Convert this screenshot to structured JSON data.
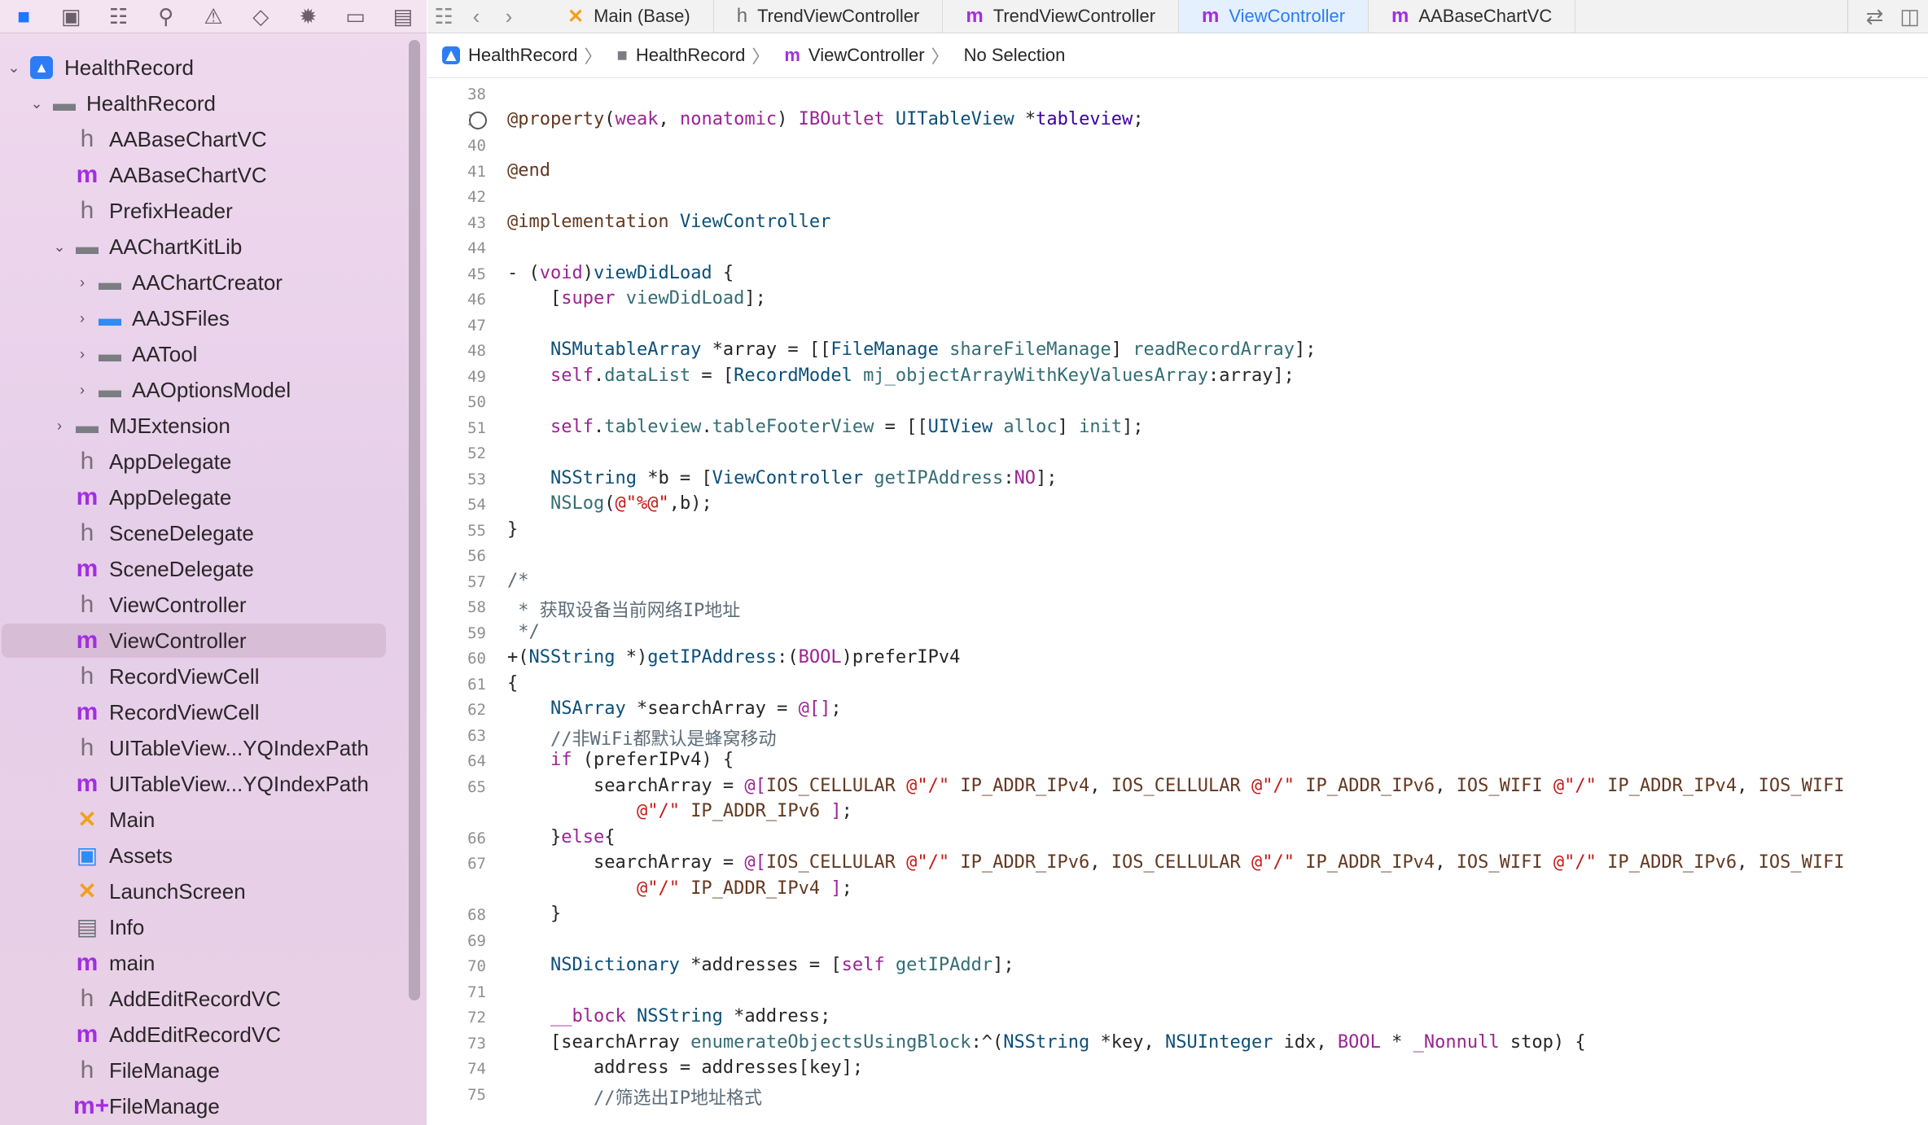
{
  "tabs": [
    {
      "icon": "xib",
      "label": "Main (Base)",
      "active": false
    },
    {
      "icon": "h",
      "label": "TrendViewController",
      "active": false
    },
    {
      "icon": "m",
      "label": "TrendViewController",
      "active": false
    },
    {
      "icon": "m",
      "label": "ViewController",
      "active": true
    },
    {
      "icon": "m",
      "label": "AABaseChartVC",
      "active": false
    }
  ],
  "jumpbar": {
    "project": "HealthRecord",
    "group": "HealthRecord",
    "file": "ViewController",
    "selection": "No Selection"
  },
  "tree": [
    {
      "indent": 0,
      "chev": "open",
      "icon": "proj",
      "label": "HealthRecord"
    },
    {
      "indent": 1,
      "chev": "open",
      "icon": "folder",
      "label": "HealthRecord"
    },
    {
      "indent": 2,
      "chev": "none",
      "icon": "h",
      "label": "AABaseChartVC"
    },
    {
      "indent": 2,
      "chev": "none",
      "icon": "m",
      "label": "AABaseChartVC"
    },
    {
      "indent": 2,
      "chev": "none",
      "icon": "h",
      "label": "PrefixHeader"
    },
    {
      "indent": 2,
      "chev": "open",
      "icon": "folder",
      "label": "AAChartKitLib"
    },
    {
      "indent": 3,
      "chev": "closed",
      "icon": "folder",
      "label": "AAChartCreator"
    },
    {
      "indent": 3,
      "chev": "closed",
      "icon": "folder-blue",
      "label": "AAJSFiles"
    },
    {
      "indent": 3,
      "chev": "closed",
      "icon": "folder",
      "label": "AATool"
    },
    {
      "indent": 3,
      "chev": "closed",
      "icon": "folder",
      "label": "AAOptionsModel"
    },
    {
      "indent": 2,
      "chev": "closed",
      "icon": "folder",
      "label": "MJExtension"
    },
    {
      "indent": 2,
      "chev": "none",
      "icon": "h",
      "label": "AppDelegate"
    },
    {
      "indent": 2,
      "chev": "none",
      "icon": "m",
      "label": "AppDelegate"
    },
    {
      "indent": 2,
      "chev": "none",
      "icon": "h",
      "label": "SceneDelegate"
    },
    {
      "indent": 2,
      "chev": "none",
      "icon": "m",
      "label": "SceneDelegate"
    },
    {
      "indent": 2,
      "chev": "none",
      "icon": "h",
      "label": "ViewController"
    },
    {
      "indent": 2,
      "chev": "none",
      "icon": "m",
      "label": "ViewController",
      "selected": true
    },
    {
      "indent": 2,
      "chev": "none",
      "icon": "h",
      "label": "RecordViewCell"
    },
    {
      "indent": 2,
      "chev": "none",
      "icon": "m",
      "label": "RecordViewCell"
    },
    {
      "indent": 2,
      "chev": "none",
      "icon": "h",
      "label": "UITableView...YQIndexPath"
    },
    {
      "indent": 2,
      "chev": "none",
      "icon": "m",
      "label": "UITableView...YQIndexPath"
    },
    {
      "indent": 2,
      "chev": "none",
      "icon": "xib",
      "label": "Main"
    },
    {
      "indent": 2,
      "chev": "none",
      "icon": "assets",
      "label": "Assets"
    },
    {
      "indent": 2,
      "chev": "none",
      "icon": "xib",
      "label": "LaunchScreen"
    },
    {
      "indent": 2,
      "chev": "none",
      "icon": "plist",
      "label": "Info"
    },
    {
      "indent": 2,
      "chev": "none",
      "icon": "m",
      "label": "main"
    },
    {
      "indent": 2,
      "chev": "none",
      "icon": "h",
      "label": "AddEditRecordVC"
    },
    {
      "indent": 2,
      "chev": "none",
      "icon": "m",
      "label": "AddEditRecordVC"
    },
    {
      "indent": 2,
      "chev": "none",
      "icon": "h",
      "label": "FileManage"
    },
    {
      "indent": 2,
      "chev": "none",
      "icon": "m",
      "label": "FileManage",
      "badge": "+"
    }
  ],
  "code": [
    {
      "n": "38",
      "tokens": []
    },
    {
      "n": "39",
      "bp": true,
      "tokens": [
        [
          "dir",
          "@property"
        ],
        [
          "",
          "("
        ],
        [
          "kw",
          "weak"
        ],
        [
          "",
          ", "
        ],
        [
          "kw",
          "nonatomic"
        ],
        [
          "",
          ") "
        ],
        [
          "kw",
          "IBOutlet"
        ],
        [
          "",
          " "
        ],
        [
          "cls",
          "UITableView"
        ],
        [
          "",
          " *"
        ],
        [
          "prop",
          "tableview"
        ],
        [
          "",
          ";"
        ]
      ]
    },
    {
      "n": "40",
      "tokens": []
    },
    {
      "n": "41",
      "tokens": [
        [
          "dir",
          "@end"
        ]
      ]
    },
    {
      "n": "42",
      "tokens": []
    },
    {
      "n": "43",
      "tokens": [
        [
          "dir",
          "@implementation"
        ],
        [
          "",
          " "
        ],
        [
          "cls",
          "ViewController"
        ]
      ]
    },
    {
      "n": "44",
      "tokens": []
    },
    {
      "n": "45",
      "tokens": [
        [
          "",
          "- ("
        ],
        [
          "kw",
          "void"
        ],
        [
          "",
          ")"
        ],
        [
          "cls",
          "viewDidLoad"
        ],
        [
          "",
          " {"
        ]
      ]
    },
    {
      "n": "46",
      "tokens": [
        [
          "",
          "    ["
        ],
        [
          "kw",
          "super"
        ],
        [
          "",
          " "
        ],
        [
          "tf",
          "viewDidLoad"
        ],
        [
          "",
          "];"
        ]
      ]
    },
    {
      "n": "47",
      "tokens": []
    },
    {
      "n": "48",
      "tokens": [
        [
          "",
          "    "
        ],
        [
          "cls",
          "NSMutableArray"
        ],
        [
          "",
          " *array = [["
        ],
        [
          "cls",
          "FileManage"
        ],
        [
          "",
          " "
        ],
        [
          "tf",
          "shareFileManage"
        ],
        [
          "",
          "] "
        ],
        [
          "tf",
          "readRecordArray"
        ],
        [
          "",
          "];"
        ]
      ]
    },
    {
      "n": "49",
      "tokens": [
        [
          "",
          "    "
        ],
        [
          "kw",
          "self"
        ],
        [
          "",
          "."
        ],
        [
          "tf",
          "dataList"
        ],
        [
          "",
          " = ["
        ],
        [
          "cls",
          "RecordModel"
        ],
        [
          "",
          " "
        ],
        [
          "tf",
          "mj_objectArrayWithKeyValuesArray"
        ],
        [
          "",
          ":array];"
        ]
      ]
    },
    {
      "n": "50",
      "tokens": []
    },
    {
      "n": "51",
      "tokens": [
        [
          "",
          "    "
        ],
        [
          "kw",
          "self"
        ],
        [
          "",
          "."
        ],
        [
          "tf",
          "tableview"
        ],
        [
          "",
          "."
        ],
        [
          "tf",
          "tableFooterView"
        ],
        [
          "",
          " = [["
        ],
        [
          "cls",
          "UIView"
        ],
        [
          "",
          " "
        ],
        [
          "tf",
          "alloc"
        ],
        [
          "",
          "] "
        ],
        [
          "tf",
          "init"
        ],
        [
          "",
          "];"
        ]
      ]
    },
    {
      "n": "52",
      "tokens": []
    },
    {
      "n": "53",
      "tokens": [
        [
          "",
          "    "
        ],
        [
          "cls",
          "NSString"
        ],
        [
          "",
          " *b = ["
        ],
        [
          "cls",
          "ViewController"
        ],
        [
          "",
          " "
        ],
        [
          "tf",
          "getIPAddress"
        ],
        [
          "",
          ":"
        ],
        [
          "kw",
          "NO"
        ],
        [
          "",
          "];"
        ]
      ]
    },
    {
      "n": "54",
      "tokens": [
        [
          "",
          "    "
        ],
        [
          "tf",
          "NSLog"
        ],
        [
          "",
          "("
        ],
        [
          "str",
          "@\"%@\""
        ],
        [
          "",
          ",b);"
        ]
      ]
    },
    {
      "n": "55",
      "tokens": [
        [
          "",
          "}"
        ]
      ]
    },
    {
      "n": "56",
      "tokens": []
    },
    {
      "n": "57",
      "tokens": [
        [
          "cmt",
          "/*"
        ]
      ]
    },
    {
      "n": "58",
      "tokens": [
        [
          "cmt",
          " * 获取设备当前网络IP地址"
        ]
      ]
    },
    {
      "n": "59",
      "tokens": [
        [
          "cmt",
          " */"
        ]
      ]
    },
    {
      "n": "60",
      "tokens": [
        [
          "",
          "+("
        ],
        [
          "cls",
          "NSString"
        ],
        [
          "",
          " *)"
        ],
        [
          "cls",
          "getIPAddress"
        ],
        [
          "",
          ":("
        ],
        [
          "kw",
          "BOOL"
        ],
        [
          "",
          ")preferIPv4"
        ]
      ]
    },
    {
      "n": "61",
      "tokens": [
        [
          "",
          "{"
        ]
      ]
    },
    {
      "n": "62",
      "tokens": [
        [
          "",
          "    "
        ],
        [
          "cls",
          "NSArray"
        ],
        [
          "",
          " *searchArray = "
        ],
        [
          "kw",
          "@[]"
        ],
        [
          "",
          ";"
        ]
      ]
    },
    {
      "n": "63",
      "tokens": [
        [
          "cmt",
          "    //非WiFi都默认是蜂窝移动"
        ]
      ]
    },
    {
      "n": "64",
      "tokens": [
        [
          "",
          "    "
        ],
        [
          "kw",
          "if"
        ],
        [
          "",
          " (preferIPv4) {"
        ]
      ]
    },
    {
      "n": "65",
      "tokens": [
        [
          "",
          "        searchArray = "
        ],
        [
          "kw",
          "@["
        ],
        [
          "dir",
          "IOS_CELLULAR"
        ],
        [
          "",
          " "
        ],
        [
          "str",
          "@\"/\""
        ],
        [
          "",
          " "
        ],
        [
          "dir",
          "IP_ADDR_IPv4"
        ],
        [
          "",
          ", "
        ],
        [
          "dir",
          "IOS_CELLULAR"
        ],
        [
          "",
          " "
        ],
        [
          "str",
          "@\"/\""
        ],
        [
          "",
          " "
        ],
        [
          "dir",
          "IP_ADDR_IPv6"
        ],
        [
          "",
          ", "
        ],
        [
          "dir",
          "IOS_WIFI"
        ],
        [
          "",
          " "
        ],
        [
          "str",
          "@\"/\""
        ],
        [
          "",
          " "
        ],
        [
          "dir",
          "IP_ADDR_IPv4"
        ],
        [
          "",
          ", "
        ],
        [
          "dir",
          "IOS_WIFI"
        ]
      ]
    },
    {
      "n": "",
      "tokens": [
        [
          "",
          "            "
        ],
        [
          "str",
          "@\"/\""
        ],
        [
          "",
          " "
        ],
        [
          "dir",
          "IP_ADDR_IPv6"
        ],
        [
          "",
          " "
        ],
        [
          "kw",
          "]"
        ],
        [
          "",
          ";"
        ]
      ]
    },
    {
      "n": "66",
      "tokens": [
        [
          "",
          "    }"
        ],
        [
          "kw",
          "else"
        ],
        [
          "",
          "{"
        ]
      ]
    },
    {
      "n": "67",
      "tokens": [
        [
          "",
          "        searchArray = "
        ],
        [
          "kw",
          "@["
        ],
        [
          "dir",
          "IOS_CELLULAR"
        ],
        [
          "",
          " "
        ],
        [
          "str",
          "@\"/\""
        ],
        [
          "",
          " "
        ],
        [
          "dir",
          "IP_ADDR_IPv6"
        ],
        [
          "",
          ", "
        ],
        [
          "dir",
          "IOS_CELLULAR"
        ],
        [
          "",
          " "
        ],
        [
          "str",
          "@\"/\""
        ],
        [
          "",
          " "
        ],
        [
          "dir",
          "IP_ADDR_IPv4"
        ],
        [
          "",
          ", "
        ],
        [
          "dir",
          "IOS_WIFI"
        ],
        [
          "",
          " "
        ],
        [
          "str",
          "@\"/\""
        ],
        [
          "",
          " "
        ],
        [
          "dir",
          "IP_ADDR_IPv6"
        ],
        [
          "",
          ", "
        ],
        [
          "dir",
          "IOS_WIFI"
        ]
      ]
    },
    {
      "n": "",
      "tokens": [
        [
          "",
          "            "
        ],
        [
          "str",
          "@\"/\""
        ],
        [
          "",
          " "
        ],
        [
          "dir",
          "IP_ADDR_IPv4"
        ],
        [
          "",
          " "
        ],
        [
          "kw",
          "]"
        ],
        [
          "",
          ";"
        ]
      ]
    },
    {
      "n": "68",
      "tokens": [
        [
          "",
          "    }"
        ]
      ]
    },
    {
      "n": "69",
      "tokens": []
    },
    {
      "n": "70",
      "tokens": [
        [
          "",
          "    "
        ],
        [
          "cls",
          "NSDictionary"
        ],
        [
          "",
          " *addresses = ["
        ],
        [
          "kw",
          "self"
        ],
        [
          "",
          " "
        ],
        [
          "tf",
          "getIPAddr"
        ],
        [
          "",
          "];"
        ]
      ]
    },
    {
      "n": "71",
      "tokens": []
    },
    {
      "n": "72",
      "tokens": [
        [
          "",
          "    "
        ],
        [
          "kw",
          "__block"
        ],
        [
          "",
          " "
        ],
        [
          "cls",
          "NSString"
        ],
        [
          "",
          " *address;"
        ]
      ]
    },
    {
      "n": "73",
      "tokens": [
        [
          "",
          "    [searchArray "
        ],
        [
          "tf",
          "enumerateObjectsUsingBlock"
        ],
        [
          "",
          ":^("
        ],
        [
          "cls",
          "NSString"
        ],
        [
          "",
          " *key, "
        ],
        [
          "cls",
          "NSUInteger"
        ],
        [
          "",
          " idx, "
        ],
        [
          "kw",
          "BOOL"
        ],
        [
          "",
          " * "
        ],
        [
          "kw",
          "_Nonnull"
        ],
        [
          "",
          " stop) {"
        ]
      ]
    },
    {
      "n": "74",
      "tokens": [
        [
          "",
          "        address = addresses[key];"
        ]
      ]
    },
    {
      "n": "75",
      "tokens": [
        [
          "cmt",
          "        //筛选出IP地址格式"
        ]
      ]
    }
  ]
}
